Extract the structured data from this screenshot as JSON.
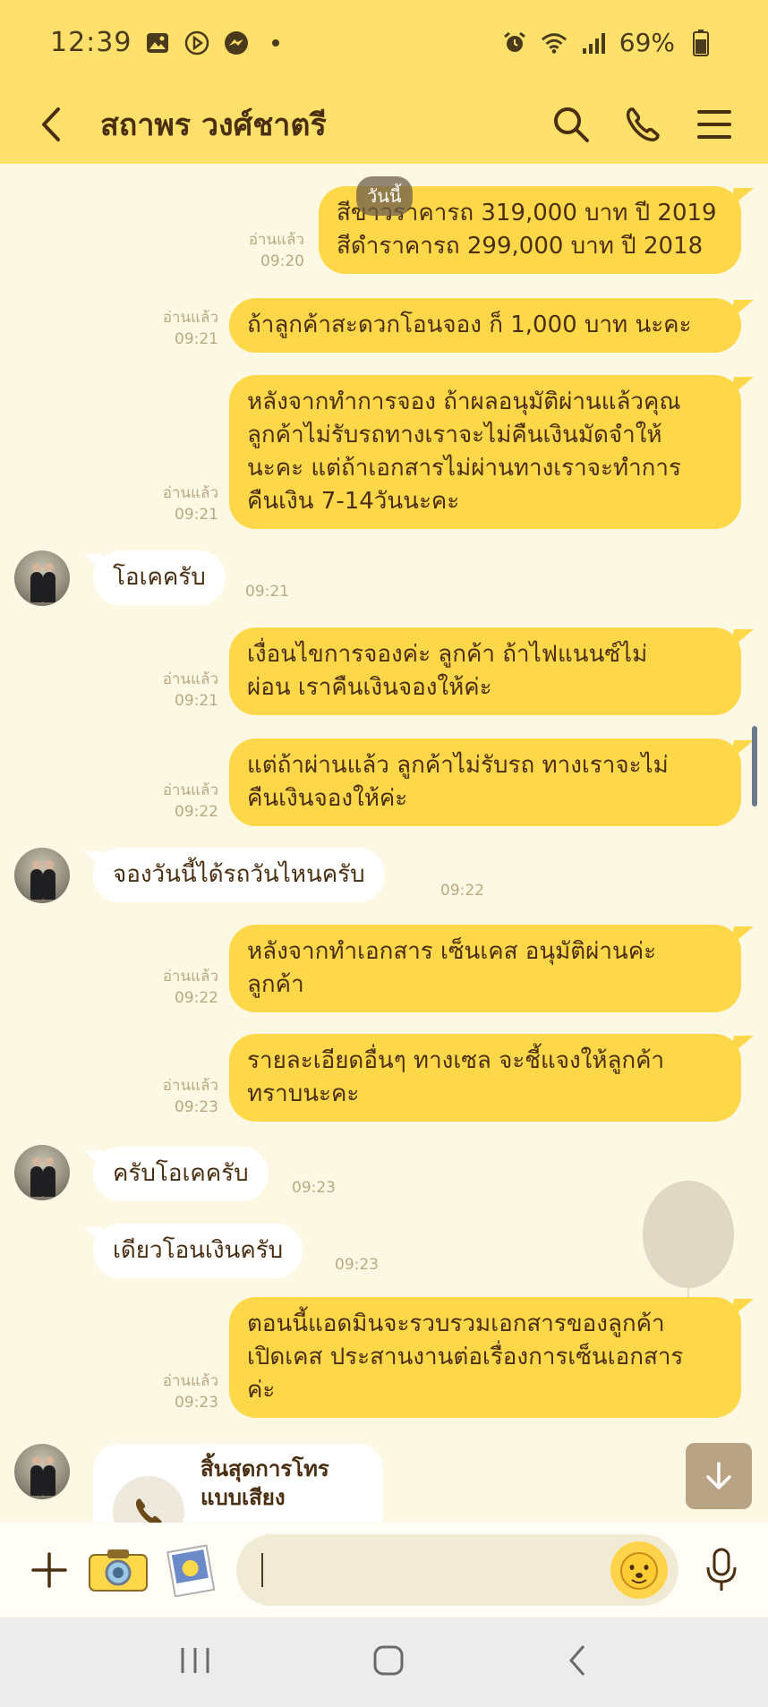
{
  "status_bar": {
    "time": "12:39",
    "battery": "69%",
    "icons": [
      "image-icon",
      "play-icon",
      "messenger-icon",
      "dot-icon",
      "alarm-icon",
      "wifi-icon",
      "signal-icon",
      "battery-icon"
    ]
  },
  "header": {
    "title": "สถาพร วงศ์ชาตรี",
    "icons": [
      "back-icon",
      "search-icon",
      "phone-icon",
      "menu-icon"
    ]
  },
  "chat": {
    "date_label": "วันนี้",
    "messages": [
      {
        "dir": "out",
        "text": "สีขาวราคารถ 319,000 บาท ปี 2019\nสีดำราคารถ  299,000 บาท ปี 2018",
        "read": "อ่านแล้ว",
        "time": "09:20"
      },
      {
        "dir": "out",
        "text": "ถ้าลูกค้าสะดวกโอนจอง ก็ 1,000 บาท นะคะ",
        "read": "อ่านแล้ว",
        "time": "09:21"
      },
      {
        "dir": "out",
        "text": "หลังจากทำการจอง ถ้าผลอนุมัติผ่านแล้วคุณ\nลูกค้าไม่รับรถทางเราจะไม่คืนเงินมัดจำให้\nนะคะ  แต่ถ้าเอกสารไม่ผ่านทางเราจะทำการ\nคืนเงิน 7-14วันนะคะ",
        "read": "อ่านแล้ว",
        "time": "09:21"
      },
      {
        "dir": "in",
        "text": "โอเคครับ",
        "time": "09:21"
      },
      {
        "dir": "out",
        "text": "เงื่อนไขการจองค่ะ ลูกค้า ถ้าไฟแนนซ์ไม่\nผ่อน เราคืนเงินจองให้ค่ะ",
        "read": "อ่านแล้ว",
        "time": "09:21"
      },
      {
        "dir": "out",
        "text": "แต่ถ้าผ่านแล้ว ลูกค้าไม่รับรถ ทางเราจะไม่\nคืนเงินจองให้ค่ะ",
        "read": "อ่านแล้ว",
        "time": "09:22"
      },
      {
        "dir": "in",
        "text": "จองวันนี้ได้รถวันไหนครับ",
        "time": "09:22"
      },
      {
        "dir": "out",
        "text": "หลังจากทำเอกสาร เซ็นเคส อนุมัติผ่านค่ะ\nลูกค้า",
        "read": "อ่านแล้ว",
        "time": "09:22"
      },
      {
        "dir": "out",
        "text": "รายละเอียดอื่นๆ ทางเซล จะชี้แจงให้ลูกค้า\nทราบนะคะ",
        "read": "อ่านแล้ว",
        "time": "09:23"
      },
      {
        "dir": "in",
        "text": "ครับโอเคครับ",
        "time": "09:23"
      },
      {
        "dir": "in",
        "text": "เดียวโอนเงินครับ",
        "time": "09:23"
      },
      {
        "dir": "out",
        "text": "ตอนนี้แอดมินจะรวบรวมเอกสารของลูกค้า\nเปิดเคส ประสานงานต่อเรื่องการเซ็นเอกสาร\nค่ะ",
        "read": "อ่านแล้ว",
        "time": "09:23"
      }
    ],
    "call_card": {
      "label": "สิ้นสุดการโทร\nแบบเสียง"
    }
  },
  "input_bar": {
    "value": "",
    "placeholder": "",
    "icons": [
      "plus-icon",
      "camera-icon",
      "photo-icon",
      "emoji-icon",
      "mic-icon"
    ]
  },
  "nav_bar": {
    "icons": [
      "recents-icon",
      "home-icon",
      "back-nav-icon"
    ]
  },
  "colors": {
    "header": "#ffe06b",
    "bubble_out": "#ffd84a",
    "bubble_in": "#ffffff",
    "background": "#fdf8e4",
    "text": "#4a2e10"
  }
}
